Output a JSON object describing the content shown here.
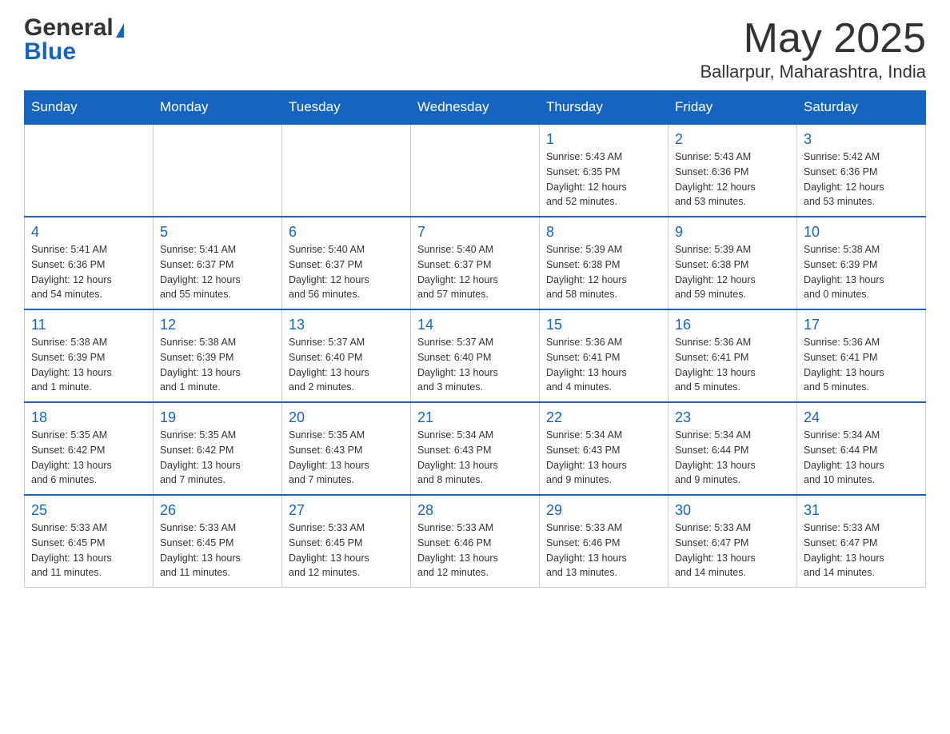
{
  "header": {
    "logo_general": "General",
    "logo_blue": "Blue",
    "month_title": "May 2025",
    "location": "Ballarpur, Maharashtra, India"
  },
  "days_of_week": [
    "Sunday",
    "Monday",
    "Tuesday",
    "Wednesday",
    "Thursday",
    "Friday",
    "Saturday"
  ],
  "weeks": [
    [
      {
        "day": "",
        "info": ""
      },
      {
        "day": "",
        "info": ""
      },
      {
        "day": "",
        "info": ""
      },
      {
        "day": "",
        "info": ""
      },
      {
        "day": "1",
        "info": "Sunrise: 5:43 AM\nSunset: 6:35 PM\nDaylight: 12 hours\nand 52 minutes."
      },
      {
        "day": "2",
        "info": "Sunrise: 5:43 AM\nSunset: 6:36 PM\nDaylight: 12 hours\nand 53 minutes."
      },
      {
        "day": "3",
        "info": "Sunrise: 5:42 AM\nSunset: 6:36 PM\nDaylight: 12 hours\nand 53 minutes."
      }
    ],
    [
      {
        "day": "4",
        "info": "Sunrise: 5:41 AM\nSunset: 6:36 PM\nDaylight: 12 hours\nand 54 minutes."
      },
      {
        "day": "5",
        "info": "Sunrise: 5:41 AM\nSunset: 6:37 PM\nDaylight: 12 hours\nand 55 minutes."
      },
      {
        "day": "6",
        "info": "Sunrise: 5:40 AM\nSunset: 6:37 PM\nDaylight: 12 hours\nand 56 minutes."
      },
      {
        "day": "7",
        "info": "Sunrise: 5:40 AM\nSunset: 6:37 PM\nDaylight: 12 hours\nand 57 minutes."
      },
      {
        "day": "8",
        "info": "Sunrise: 5:39 AM\nSunset: 6:38 PM\nDaylight: 12 hours\nand 58 minutes."
      },
      {
        "day": "9",
        "info": "Sunrise: 5:39 AM\nSunset: 6:38 PM\nDaylight: 12 hours\nand 59 minutes."
      },
      {
        "day": "10",
        "info": "Sunrise: 5:38 AM\nSunset: 6:39 PM\nDaylight: 13 hours\nand 0 minutes."
      }
    ],
    [
      {
        "day": "11",
        "info": "Sunrise: 5:38 AM\nSunset: 6:39 PM\nDaylight: 13 hours\nand 1 minute."
      },
      {
        "day": "12",
        "info": "Sunrise: 5:38 AM\nSunset: 6:39 PM\nDaylight: 13 hours\nand 1 minute."
      },
      {
        "day": "13",
        "info": "Sunrise: 5:37 AM\nSunset: 6:40 PM\nDaylight: 13 hours\nand 2 minutes."
      },
      {
        "day": "14",
        "info": "Sunrise: 5:37 AM\nSunset: 6:40 PM\nDaylight: 13 hours\nand 3 minutes."
      },
      {
        "day": "15",
        "info": "Sunrise: 5:36 AM\nSunset: 6:41 PM\nDaylight: 13 hours\nand 4 minutes."
      },
      {
        "day": "16",
        "info": "Sunrise: 5:36 AM\nSunset: 6:41 PM\nDaylight: 13 hours\nand 5 minutes."
      },
      {
        "day": "17",
        "info": "Sunrise: 5:36 AM\nSunset: 6:41 PM\nDaylight: 13 hours\nand 5 minutes."
      }
    ],
    [
      {
        "day": "18",
        "info": "Sunrise: 5:35 AM\nSunset: 6:42 PM\nDaylight: 13 hours\nand 6 minutes."
      },
      {
        "day": "19",
        "info": "Sunrise: 5:35 AM\nSunset: 6:42 PM\nDaylight: 13 hours\nand 7 minutes."
      },
      {
        "day": "20",
        "info": "Sunrise: 5:35 AM\nSunset: 6:43 PM\nDaylight: 13 hours\nand 7 minutes."
      },
      {
        "day": "21",
        "info": "Sunrise: 5:34 AM\nSunset: 6:43 PM\nDaylight: 13 hours\nand 8 minutes."
      },
      {
        "day": "22",
        "info": "Sunrise: 5:34 AM\nSunset: 6:43 PM\nDaylight: 13 hours\nand 9 minutes."
      },
      {
        "day": "23",
        "info": "Sunrise: 5:34 AM\nSunset: 6:44 PM\nDaylight: 13 hours\nand 9 minutes."
      },
      {
        "day": "24",
        "info": "Sunrise: 5:34 AM\nSunset: 6:44 PM\nDaylight: 13 hours\nand 10 minutes."
      }
    ],
    [
      {
        "day": "25",
        "info": "Sunrise: 5:33 AM\nSunset: 6:45 PM\nDaylight: 13 hours\nand 11 minutes."
      },
      {
        "day": "26",
        "info": "Sunrise: 5:33 AM\nSunset: 6:45 PM\nDaylight: 13 hours\nand 11 minutes."
      },
      {
        "day": "27",
        "info": "Sunrise: 5:33 AM\nSunset: 6:45 PM\nDaylight: 13 hours\nand 12 minutes."
      },
      {
        "day": "28",
        "info": "Sunrise: 5:33 AM\nSunset: 6:46 PM\nDaylight: 13 hours\nand 12 minutes."
      },
      {
        "day": "29",
        "info": "Sunrise: 5:33 AM\nSunset: 6:46 PM\nDaylight: 13 hours\nand 13 minutes."
      },
      {
        "day": "30",
        "info": "Sunrise: 5:33 AM\nSunset: 6:47 PM\nDaylight: 13 hours\nand 14 minutes."
      },
      {
        "day": "31",
        "info": "Sunrise: 5:33 AM\nSunset: 6:47 PM\nDaylight: 13 hours\nand 14 minutes."
      }
    ]
  ]
}
